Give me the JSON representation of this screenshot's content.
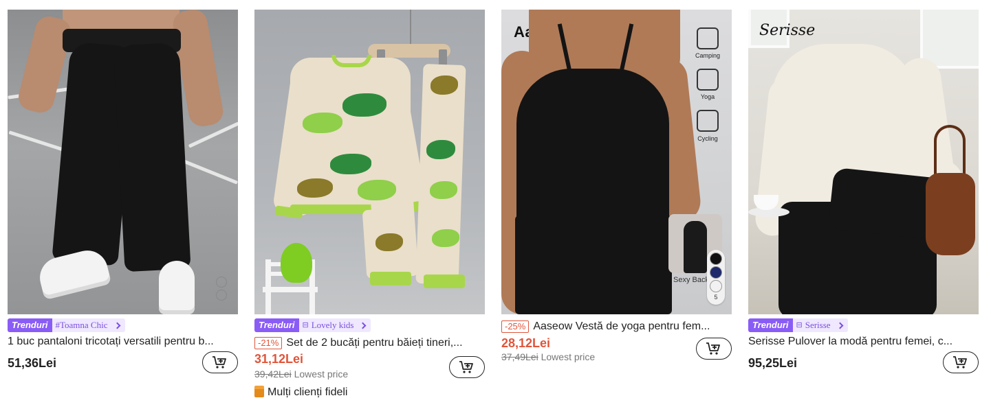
{
  "products": [
    {
      "badge": "Trenduri",
      "tag": "#Toamna Chic",
      "discount": "",
      "title": "1 buc pantaloni tricotați versatili pentru b...",
      "price": "51,36Lei",
      "old_price": "",
      "old_price_note": "",
      "extra": "",
      "swatch_colors": [
        "#111111",
        "#e8e8e8"
      ]
    },
    {
      "badge": "Trenduri",
      "tag": "Lovely kids",
      "discount": "-21%",
      "title": "Set de 2 bucăți pentru băieți tineri,...",
      "price": "31,12Lei",
      "old_price": "39,42Lei",
      "old_price_note": "Lowest price",
      "extra": "Mulți clienți fideli"
    },
    {
      "badge": "",
      "tag": "",
      "discount": "-25%",
      "title": "Aaseow Vestă de yoga pentru fem...",
      "price": "28,12Lei",
      "old_price": "37,49Lei",
      "old_price_note": "Lowest price",
      "extra": "",
      "image_brand": "Aaseow",
      "activities": [
        "Camping",
        "Yoga",
        "Cycling"
      ],
      "inset_caption": "Sexy Back",
      "swatch_colors": [
        "#111111",
        "#1e2a6b",
        "#f2f2f2"
      ],
      "swatch_count": "5"
    },
    {
      "badge": "Trenduri",
      "tag": "Serisse",
      "discount": "",
      "title": "Serisse Pulover la modă pentru femei, c...",
      "price": "95,25Lei",
      "old_price": "",
      "old_price_note": "",
      "extra": "",
      "image_brand": "Serisse"
    }
  ],
  "colors": {
    "trend_badge": "#8a5cf6",
    "sale_price": "#e0553a"
  },
  "icons": [
    "add-to-cart-icon",
    "chevron-right-icon",
    "shop-icon",
    "store-icon"
  ]
}
